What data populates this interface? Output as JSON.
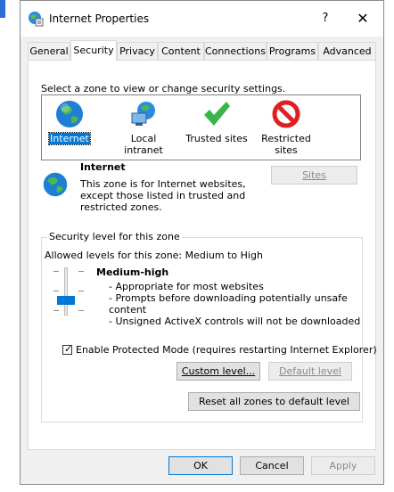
{
  "window": {
    "title": "Internet Properties",
    "help_label": "?",
    "close_label": "✕"
  },
  "tabs": [
    {
      "label": "General"
    },
    {
      "label": "Security"
    },
    {
      "label": "Privacy"
    },
    {
      "label": "Content"
    },
    {
      "label": "Connections"
    },
    {
      "label": "Programs"
    },
    {
      "label": "Advanced"
    }
  ],
  "security": {
    "zone_prompt": "Select a zone to view or change security settings.",
    "zones": [
      {
        "label": "Internet",
        "icon": "globe-icon"
      },
      {
        "label": "Local intranet",
        "icon": "intranet-icon"
      },
      {
        "label": "Trusted sites",
        "icon": "checkmark-icon"
      },
      {
        "label_line1": "Restricted",
        "label_line2": "sites",
        "icon": "prohibited-icon"
      }
    ],
    "selected_zone": {
      "name": "Internet",
      "desc_line1": "This zone is for Internet websites,",
      "desc_line2": "except those listed in trusted and",
      "desc_line3": "restricted zones."
    },
    "sites_button": "Sites",
    "level_group_title": "Security level for this zone",
    "allowed_levels": "Allowed levels for this zone: Medium to High",
    "level_name": "Medium-high",
    "level_details": [
      "- Appropriate for most websites",
      "- Prompts before downloading potentially unsafe",
      "content",
      "- Unsigned ActiveX controls will not be downloaded"
    ],
    "protected_mode_label": "Enable Protected Mode (requires restarting Internet Explorer)",
    "protected_mode_checked": true,
    "custom_level_button": "Custom level...",
    "default_level_button": "Default level",
    "reset_button": "Reset all zones to default level"
  },
  "footer": {
    "ok": "OK",
    "cancel": "Cancel",
    "apply": "Apply"
  },
  "colors": {
    "accent": "#0078d7",
    "window_bg": "#f0f0f0"
  }
}
